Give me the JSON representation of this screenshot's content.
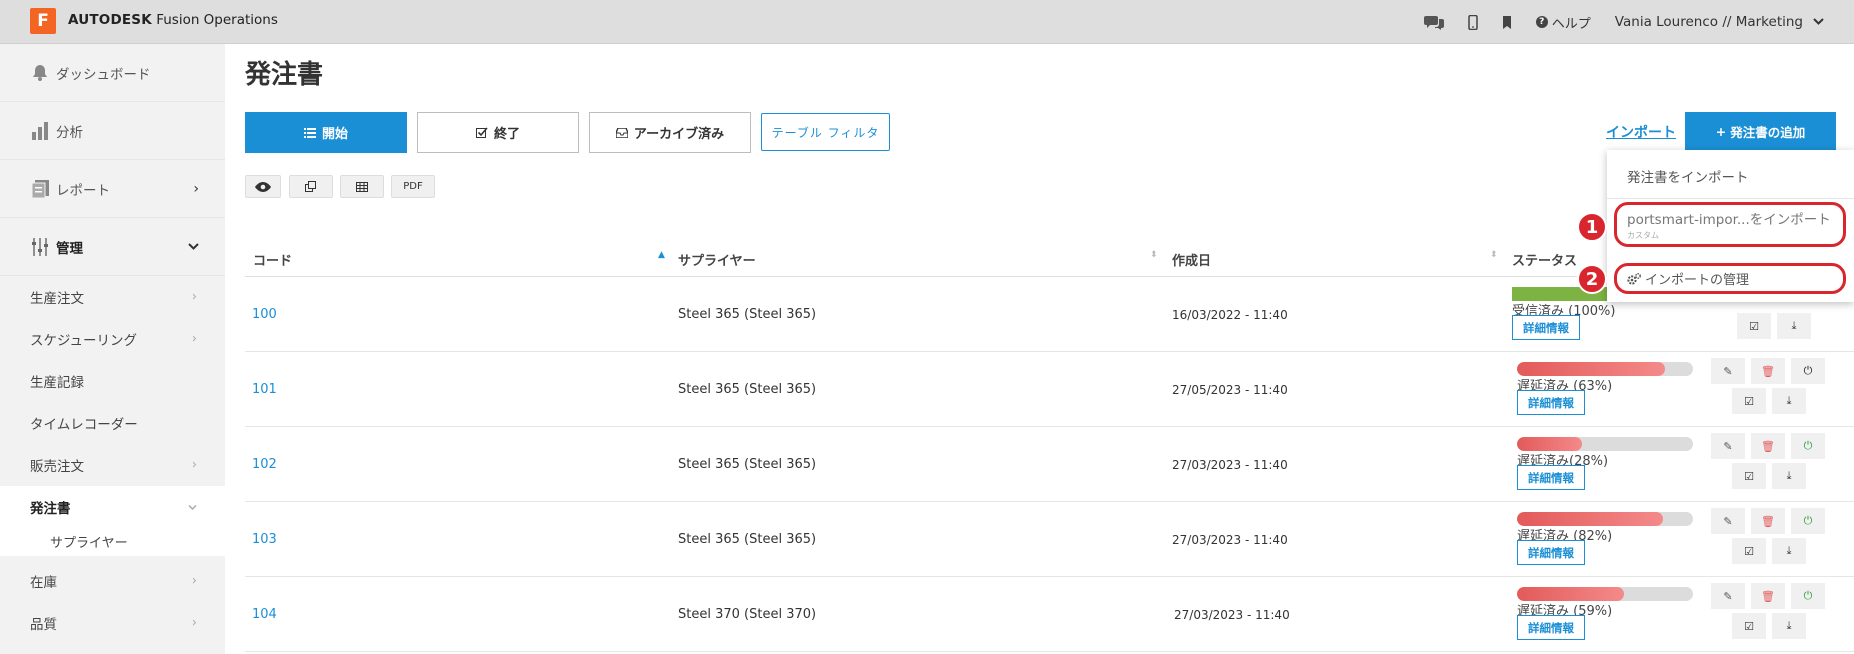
{
  "header": {
    "logo_letter": "F",
    "brand_bold": "AUTODESK",
    "brand_rest": " Fusion Operations",
    "help_label": "ヘルプ",
    "user": "Vania Lourenco // Marketing"
  },
  "sidebar": {
    "dashboard": "ダッシュボード",
    "analysis": "分析",
    "reports": "レポート",
    "manage": "管理",
    "production_order": "生産注文",
    "scheduling": "スケジューリング",
    "production_record": "生産記録",
    "time_recorder": "タイムレコーダー",
    "sales_order": "販売注文",
    "purchase_order": "発注書",
    "supplier": "サプライヤー",
    "inventory": "在庫",
    "quality": "品質"
  },
  "main": {
    "title": "発注書",
    "tabs": [
      "開始",
      "終了",
      "アーカイブ済み"
    ],
    "filter": "テーブル フィルタ",
    "tools": {
      "pdf": "PDF"
    },
    "import_link": "インポート",
    "add_button": "発注書の追加",
    "columns": [
      "コード",
      "サプライヤー",
      "作成日",
      "ステータス"
    ],
    "detail_label": "詳細情報"
  },
  "rows": [
    {
      "code": "100",
      "supplier": "Steel 365 (Steel 365)",
      "date": "16/03/2022 - 11:40",
      "status": "受信済み (100%)",
      "progress": 100
    },
    {
      "code": "101",
      "supplier": "Steel 365 (Steel 365)",
      "date": "27/05/2023 - 11:40",
      "status": "遅延済み (63%)",
      "progress": 84
    },
    {
      "code": "102",
      "supplier": "Steel 365 (Steel 365)",
      "date": "27/03/2023 - 11:40",
      "status": "遅延済み(28%)",
      "progress": 37
    },
    {
      "code": "103",
      "supplier": "Steel 365 (Steel 365)",
      "date": "27/03/2023 - 11:40",
      "status": "遅延済み (82%)",
      "progress": 83
    },
    {
      "code": "104",
      "supplier": "Steel 370 (Steel 370)",
      "date": "27/03/2023 - 11:40",
      "status": "遅延済み (59%)",
      "progress": 61
    }
  ],
  "dropdown": {
    "header": "発注書をインポート",
    "item1": "portsmart-impor...をインポート",
    "item1_sub": "カスタム",
    "item2": "インポートの管理"
  },
  "annotations": {
    "badge1": "1",
    "badge2": "2"
  },
  "colors": {
    "accent": "#1b8fd6",
    "annotation": "#d9262e",
    "received": "#7cb342",
    "delayed": "#e35a5a"
  }
}
